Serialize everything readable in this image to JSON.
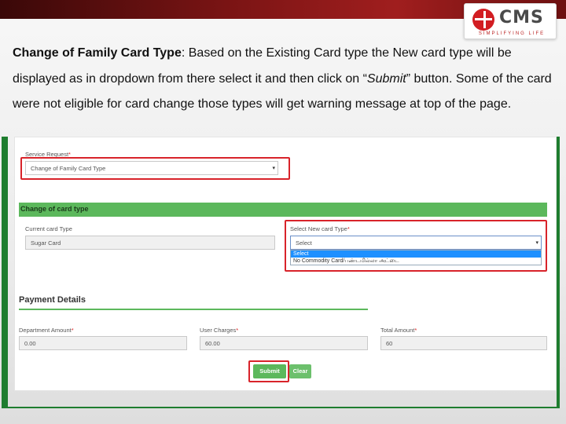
{
  "logo": {
    "wordmark": "CMS",
    "tagline": "SIMPLIFYING LIFE"
  },
  "description": {
    "heading": "Change of Family Card Type",
    "text_part1": ": Based on the Existing Card type the New card type will be displayed as in dropdown from there select it and then click on “",
    "submit_word": "Submit",
    "text_part2": "” button. Some of the card were not eligible for card change those types will get warning message at top of the page."
  },
  "form": {
    "service_request": {
      "label": "Service Request",
      "required_mark": "*",
      "value": "Change of Family Card Type"
    },
    "section_title": "Change of card type",
    "current_card_type": {
      "label": "Current card Type",
      "value": "Sugar Card"
    },
    "new_card_type": {
      "label": "Select New card Type",
      "required_mark": "*",
      "value": "Select",
      "options": [
        "Select",
        "No Commodity Card/பண்டமில்லா அட்டை"
      ]
    },
    "payment_title": "Payment Details",
    "department_amount": {
      "label": "Department Amount",
      "required_mark": "*",
      "value": "0.00"
    },
    "user_charges": {
      "label": "User Charges",
      "required_mark": "*",
      "value": "60.00"
    },
    "total_amount": {
      "label": "Total Amount",
      "required_mark": "*",
      "value": "60"
    },
    "submit_label": "Submit",
    "clear_label": "Clear"
  },
  "colors": {
    "accent_green": "#5cb85c",
    "highlight_red": "#d8232a",
    "band_red": "#8b1a1a"
  }
}
